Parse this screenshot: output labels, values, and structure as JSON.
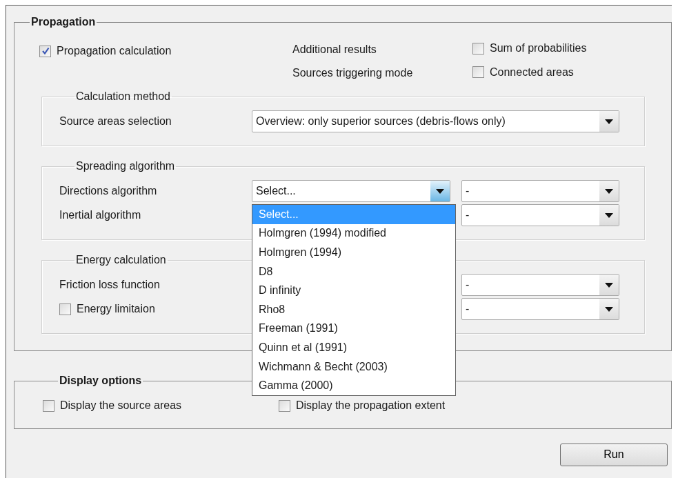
{
  "propagation": {
    "title": "Propagation",
    "main_option": {
      "label": "Propagation calculation",
      "checked": true
    },
    "extra_options": [
      {
        "label": "Additional results",
        "option": {
          "label": "Sum of probabilities",
          "checked": false
        }
      },
      {
        "label": "Sources triggering mode",
        "option": {
          "label": "Connected areas",
          "checked": false
        }
      }
    ],
    "groups": [
      {
        "title": "Calculation method",
        "rows": [
          {
            "kind": "wide",
            "label": "Source areas selection",
            "selects": [
              {
                "value": "Overview: only superior sources (debris-flows only)"
              }
            ]
          }
        ]
      },
      {
        "title": "Spreading algorithm",
        "rows": [
          {
            "kind": "pair",
            "label": "Directions algorithm",
            "selects": [
              {
                "value": "Select...",
                "open": true,
                "options": [
                  {
                    "label": "Select...",
                    "selected": true
                  },
                  {
                    "label": "Holmgren (1994) modified",
                    "selected": false
                  },
                  {
                    "label": "Holmgren (1994)",
                    "selected": false
                  },
                  {
                    "label": "D8",
                    "selected": false
                  },
                  {
                    "label": "D infinity",
                    "selected": false
                  },
                  {
                    "label": "Rho8",
                    "selected": false
                  },
                  {
                    "label": "Freeman (1991)",
                    "selected": false
                  },
                  {
                    "label": "Quinn et al (1991)",
                    "selected": false
                  },
                  {
                    "label": "Wichmann & Becht (2003)",
                    "selected": false
                  },
                  {
                    "label": "Gamma (2000)",
                    "selected": false
                  }
                ]
              },
              {
                "value": "-"
              }
            ]
          },
          {
            "kind": "right",
            "label": "Inertial algorithm",
            "selects": [
              {
                "value": "-"
              }
            ]
          }
        ]
      },
      {
        "title": "Energy calculation",
        "rows": [
          {
            "kind": "right",
            "label": "Friction loss function",
            "selects": [
              {
                "value": "-"
              }
            ]
          },
          {
            "kind": "check-right",
            "label": "Energy limitaion",
            "checked": false,
            "selects": [
              {
                "value": "-"
              }
            ]
          }
        ]
      }
    ]
  },
  "display_options": {
    "title": "Display options",
    "options": [
      {
        "label": "Display the source areas",
        "checked": false
      },
      {
        "label": "Display the propagation extent",
        "checked": false
      }
    ]
  },
  "run_button": "Run"
}
